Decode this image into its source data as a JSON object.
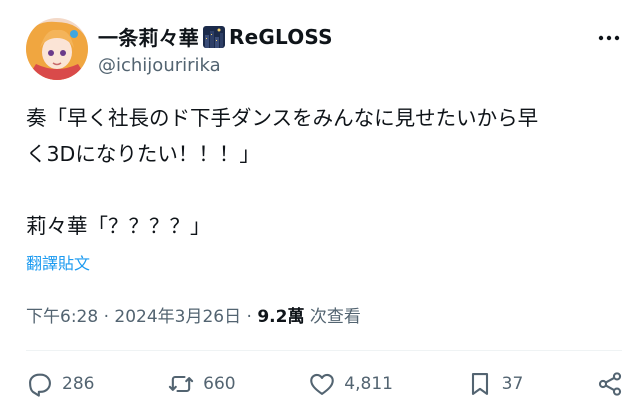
{
  "author": {
    "display_name": "一条莉々華",
    "org_name": "ReGLOSS",
    "handle": "@ichijouririka"
  },
  "tweet": {
    "line1": "奏「早く社長のド下手ダンスをみんなに見せたいから早",
    "line2": "く3Dになりたい！！！」",
    "line3": "莉々華「？？？？」",
    "translate_label": "翻譯貼文"
  },
  "meta": {
    "time": "下午6:28",
    "separator1": " · ",
    "date": "2024年3月26日",
    "separator2": " · ",
    "views": "9.2萬",
    "views_label": " 次查看"
  },
  "actions": {
    "replies": "286",
    "reposts": "660",
    "likes": "4,811",
    "bookmarks": "37"
  },
  "colors": {
    "link": "#1d9bf0",
    "secondary": "#536471",
    "text": "#0f1419"
  }
}
